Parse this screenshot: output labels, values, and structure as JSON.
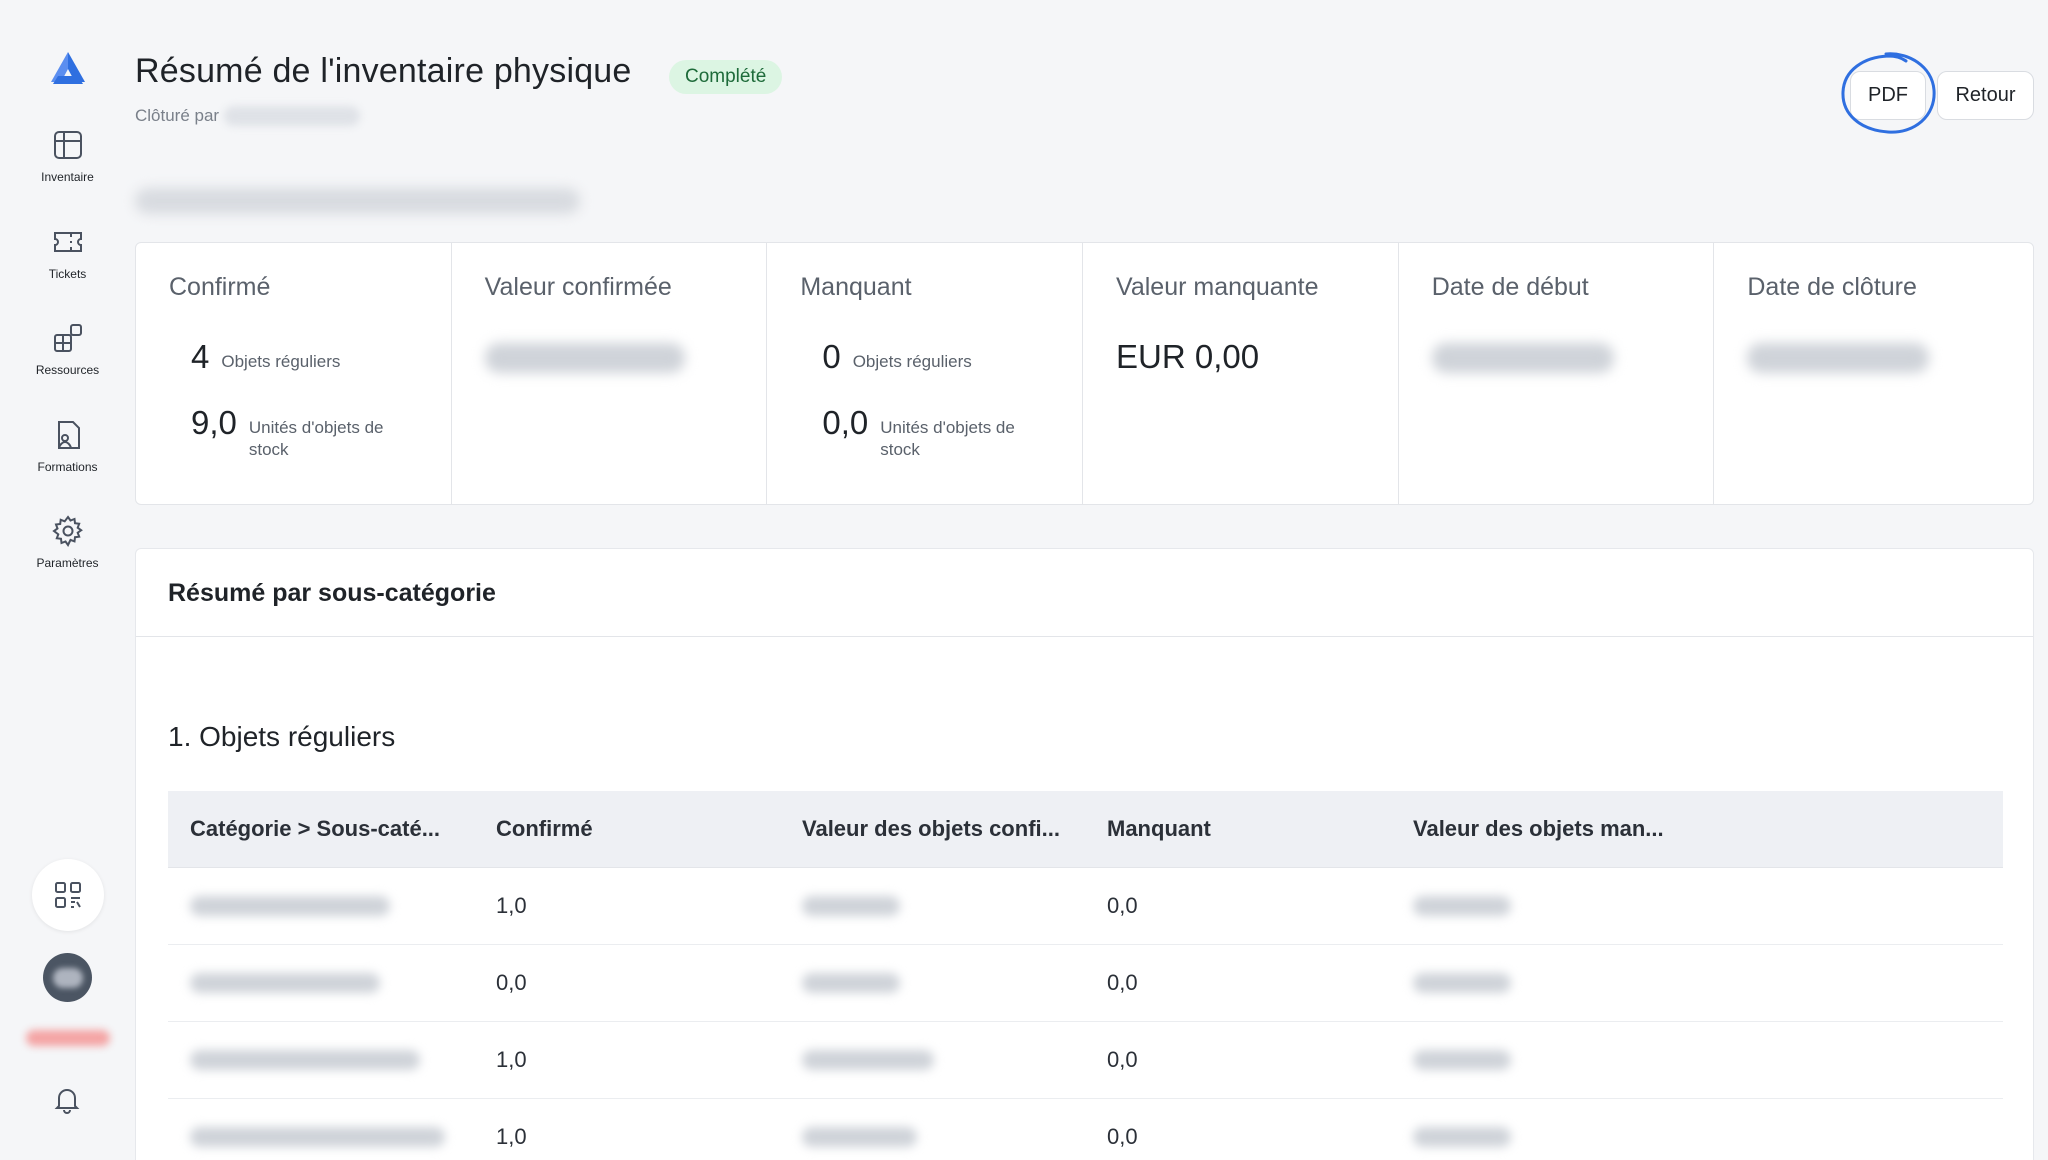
{
  "sidebar": {
    "items": [
      {
        "label": "Inventaire",
        "icon": "grid-table-icon"
      },
      {
        "label": "Tickets",
        "icon": "ticket-icon"
      },
      {
        "label": "Ressources",
        "icon": "blocks-icon"
      },
      {
        "label": "Formations",
        "icon": "book-user-icon"
      },
      {
        "label": "Paramètres",
        "icon": "gear-icon"
      }
    ]
  },
  "header": {
    "title": "Résumé de l'inventaire physique",
    "status": "Complété",
    "closed_by_label": "Clôturé par",
    "pdf_label": "PDF",
    "back_label": "Retour"
  },
  "stats": {
    "confirmed": {
      "title": "Confirmé",
      "regular_count": "4",
      "regular_label": "Objets réguliers",
      "stock_count": "9,0",
      "stock_label": "Unités d'objets de stock"
    },
    "confirmed_value": {
      "title": "Valeur confirmée"
    },
    "missing": {
      "title": "Manquant",
      "regular_count": "0",
      "regular_label": "Objets réguliers",
      "stock_count": "0,0",
      "stock_label": "Unités d'objets de stock"
    },
    "missing_value": {
      "title": "Valeur manquante",
      "value": "EUR 0,00"
    },
    "start_date": {
      "title": "Date de début"
    },
    "close_date": {
      "title": "Date de clôture"
    }
  },
  "subcategory": {
    "title": "Résumé par sous-catégorie",
    "section_title": "1. Objets réguliers",
    "columns": [
      "Catégorie > Sous-caté...",
      "Confirmé",
      "Valeur des objets confi...",
      "Manquant",
      "Valeur des objets man..."
    ],
    "rows": [
      {
        "confirmed": "1,0",
        "missing": "0,0"
      },
      {
        "confirmed": "0,0",
        "missing": "0,0"
      },
      {
        "confirmed": "1,0",
        "missing": "0,0"
      },
      {
        "confirmed": "1,0",
        "missing": "0,0"
      }
    ]
  },
  "colors": {
    "accent": "#2f6fe0",
    "badge_bg": "#dcf5e3",
    "badge_text": "#1e6b3a"
  }
}
